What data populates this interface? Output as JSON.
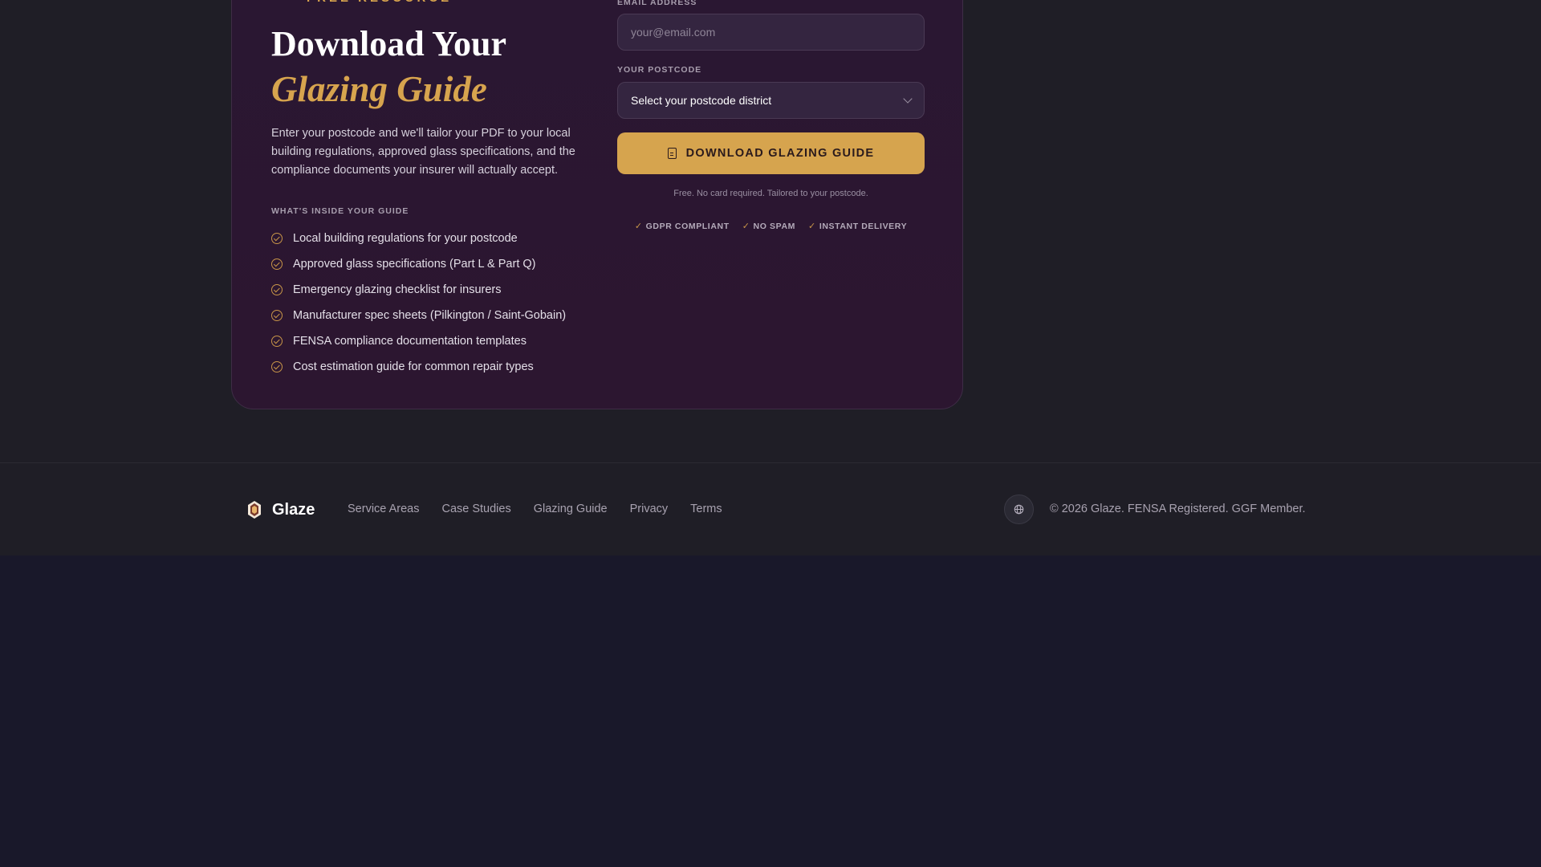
{
  "card": {
    "eyebrow": "FREE RESOURCE",
    "title_line1": "Download Your",
    "title_line2": "Glazing Guide",
    "intro": "Enter your postcode and we'll tailor your PDF to your local building regulations, approved glass specifications, and the compliance documents your insurer will actually accept.",
    "inside_label": "WHAT'S INSIDE YOUR GUIDE",
    "features": [
      "Local building regulations for your postcode",
      "Approved glass specifications (Part L & Part Q)",
      "Emergency glazing checklist for insurers",
      "Manufacturer spec sheets (Pilkington / Saint-Gobain)",
      "FENSA compliance documentation templates",
      "Cost estimation guide for common repair types"
    ]
  },
  "form": {
    "email_label": "EMAIL ADDRESS",
    "email_placeholder": "your@email.com",
    "email_value": "",
    "postcode_label": "YOUR POSTCODE",
    "postcode_selected": "Select your postcode district",
    "cta_label": "DOWNLOAD GLAZING GUIDE",
    "cta_note": "Free. No card required. Tailored to your postcode.",
    "trust_badges": [
      "GDPR COMPLIANT",
      "NO SPAM",
      "INSTANT DELIVERY"
    ]
  },
  "footer": {
    "brand_name": "Glaze",
    "nav": [
      "Service Areas",
      "Case Studies",
      "Glazing Guide",
      "Privacy",
      "Terms"
    ],
    "copyright": "© 2026 Glaze. FENSA Registered. GGF Member."
  },
  "colors": {
    "accent": "#d6a44e",
    "card_bg": "#2a1732",
    "page_bg": "#19182a",
    "footer_bg": "#1f1e26"
  },
  "icons": {
    "feature_bullet": "check-circle-icon",
    "dropdown": "chevron-down-icon",
    "cta": "document-icon",
    "trust": "check-icon",
    "brand": "glaze-logo-icon",
    "language": "globe-icon"
  }
}
